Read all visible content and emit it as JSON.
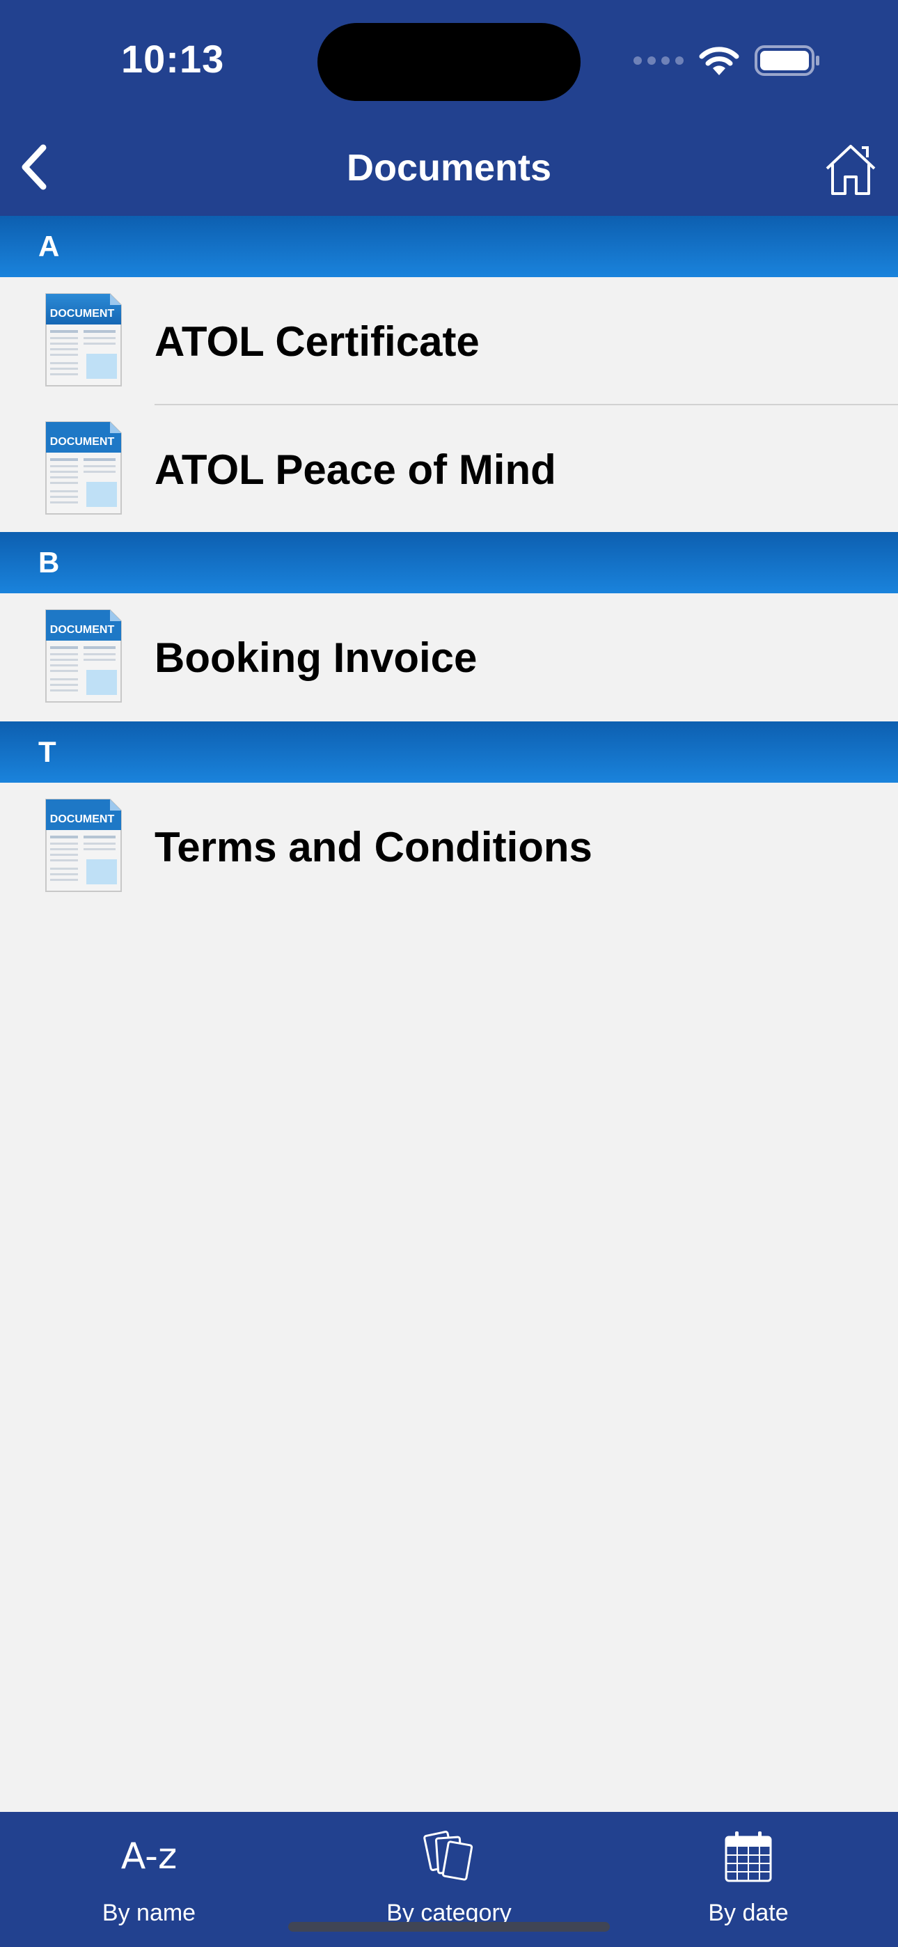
{
  "status": {
    "time": "10:13"
  },
  "nav": {
    "title": "Documents"
  },
  "sections": [
    {
      "letter": "A",
      "items": [
        "ATOL Certificate",
        "ATOL Peace of Mind"
      ]
    },
    {
      "letter": "B",
      "items": [
        "Booking Invoice"
      ]
    },
    {
      "letter": "T",
      "items": [
        "Terms and Conditions"
      ]
    }
  ],
  "doc_icon_label": "DOCUMENT",
  "tabs": [
    {
      "icon_text": "A-z",
      "label": "By name"
    },
    {
      "label": "By category"
    },
    {
      "label": "By date"
    }
  ],
  "colors": {
    "nav_bg": "#22418f",
    "section_bg": "#1474c8",
    "content_bg": "#f2f2f2"
  }
}
